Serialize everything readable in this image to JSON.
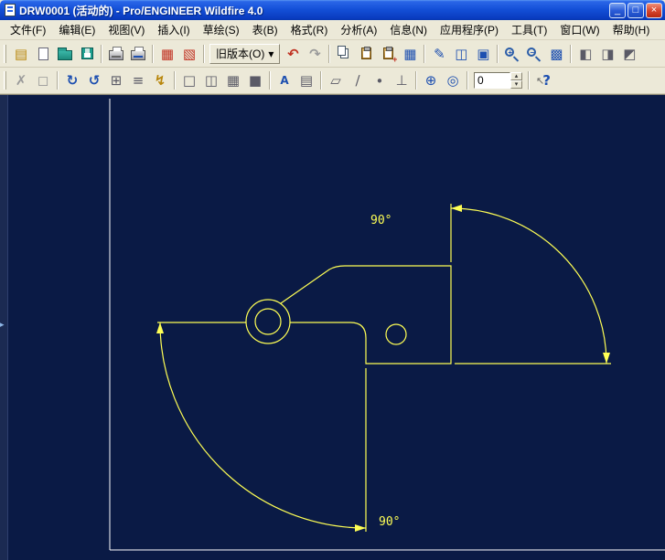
{
  "window": {
    "title": "DRW0001 (活动的) - Pro/ENGINEER Wildfire 4.0"
  },
  "menubar": {
    "items": [
      "文件(F)",
      "编辑(E)",
      "视图(V)",
      "插入(I)",
      "草绘(S)",
      "表(B)",
      "格式(R)",
      "分析(A)",
      "信息(N)",
      "应用程序(P)",
      "工具(T)",
      "窗口(W)",
      "帮助(H)"
    ]
  },
  "toolbar1": {
    "old_version_label": "旧版本(O)"
  },
  "toolbar2": {
    "sheet_value": "0"
  },
  "drawing": {
    "dim_upper_label": "90°",
    "dim_lower_label": "90°",
    "colors": {
      "background": "#0a1a45",
      "geometry": "#ffff55",
      "sheet_border": "#ffffff"
    }
  },
  "icons": {
    "minimize": "_",
    "maximize": "□",
    "close": "×",
    "new_format": "▤",
    "red_update": "▦",
    "red_regen": "▧",
    "dropdown": "▾",
    "undo": "↶",
    "redo": "↷",
    "update_tables": "▦",
    "sketch": "✎",
    "insert_view": "◫",
    "lock_view": "▣",
    "refit": "▩",
    "win_a": "◧",
    "win_b": "◨",
    "win_c": "◩",
    "delete_x": "✗",
    "erase": "◻",
    "repaint": "↻",
    "redraw": "↺",
    "grid": "⊞",
    "lines": "≡",
    "flash": "↯",
    "style_wire": "□",
    "style_hidden": "◫",
    "style_nohid": "▦",
    "style_shade": "■",
    "note_a": "A",
    "layers": "▤",
    "datum_plane": "▱",
    "datum_axis": "∕",
    "datum_point": "∙",
    "datum_csys": "⊥",
    "spin_center": "⊕",
    "orient": "◎",
    "spin_up": "▴",
    "spin_down": "▾",
    "plus": "+",
    "minus": "−",
    "help_q": "?",
    "help_arrow": "↖",
    "sash": "▸"
  }
}
